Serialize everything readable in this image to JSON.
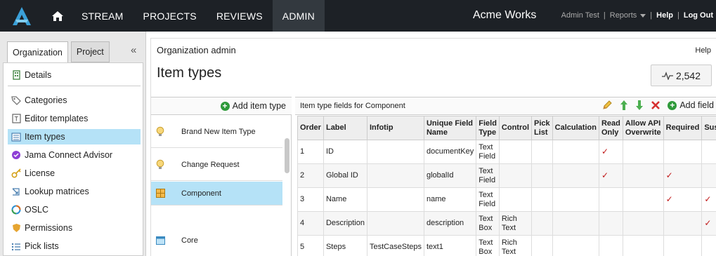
{
  "topnav": {
    "items": [
      "STREAM",
      "PROJECTS",
      "REVIEWS",
      "ADMIN"
    ],
    "org_name": "Acme Works",
    "user": "Admin Test",
    "reports": "Reports",
    "help": "Help",
    "logout": "Log Out"
  },
  "left": {
    "tabs": [
      "Organization",
      "Project"
    ],
    "items": [
      {
        "label": "Details",
        "icon": "building-icon"
      },
      {
        "label": "Categories",
        "icon": "tag-icon"
      },
      {
        "label": "Editor templates",
        "icon": "template-icon"
      },
      {
        "label": "Item types",
        "icon": "list-icon"
      },
      {
        "label": "Jama Connect Advisor",
        "icon": "advisor-icon"
      },
      {
        "label": "License",
        "icon": "key-icon"
      },
      {
        "label": "Lookup matrices",
        "icon": "matrix-icon"
      },
      {
        "label": "OSLC",
        "icon": "oslc-icon"
      },
      {
        "label": "Permissions",
        "icon": "permissions-icon"
      },
      {
        "label": "Pick lists",
        "icon": "picklist-icon"
      }
    ]
  },
  "main": {
    "breadcrumb": "Organization admin",
    "help": "Help",
    "title": "Item types",
    "count": "2,542"
  },
  "item_types": {
    "add_label": "Add item type",
    "items": [
      "Brand New Item Type",
      "Change Request",
      "Component",
      "Core"
    ]
  },
  "fields": {
    "heading": "Item type fields for Component",
    "add_field": "Add field",
    "columns": [
      "Order",
      "Label",
      "Infotip",
      "Unique Field Name",
      "Field Type",
      "Control",
      "Pick List",
      "Calculation",
      "Read Only",
      "Allow API Overwrite",
      "Required",
      "Susp"
    ],
    "rows": [
      [
        "1",
        "ID",
        "",
        "documentKey",
        "Text Field",
        "",
        "",
        "",
        "✓",
        "",
        "",
        ""
      ],
      [
        "2",
        "Global ID",
        "",
        "globalId",
        "Text Field",
        "",
        "",
        "",
        "✓",
        "",
        "✓",
        ""
      ],
      [
        "3",
        "Name",
        "",
        "name",
        "Text Field",
        "",
        "",
        "",
        "",
        "",
        "✓",
        "✓"
      ],
      [
        "4",
        "Description",
        "",
        "description",
        "Text Box",
        "Rich Text",
        "",
        "",
        "",
        "",
        "",
        "✓"
      ],
      [
        "5",
        "Steps",
        "TestCaseSteps",
        "text1",
        "Text Box",
        "Rich Text",
        "",
        "",
        "",
        "",
        "",
        ""
      ]
    ]
  },
  "colors": {
    "nav_bg": "#1d2126",
    "selected": "#b5e2f7",
    "accent_green": "#2e9a3a",
    "check_red": "#c01818"
  }
}
